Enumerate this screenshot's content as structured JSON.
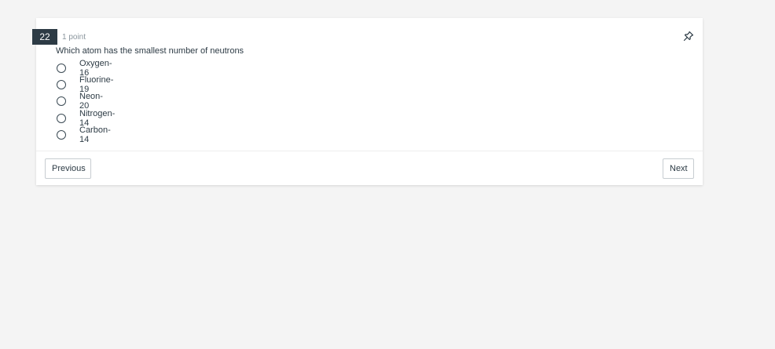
{
  "question": {
    "number": "22",
    "points": "1 point",
    "text": "Which atom has the smallest number of neutrons",
    "answers": [
      {
        "label": "Oxygen-16"
      },
      {
        "label": "Fluorine-19"
      },
      {
        "label": "Neon-20"
      },
      {
        "label": "Nitrogen-14"
      },
      {
        "label": "Carbon-14"
      }
    ]
  },
  "navigation": {
    "previous_label": "Previous",
    "next_label": "Next"
  },
  "icons": {
    "pin": "pin-icon"
  },
  "colors": {
    "background": "#f4f4f4",
    "card": "#ffffff",
    "number_badge": "#2d3b45",
    "text": "#2d3b45",
    "muted": "#8b969e",
    "button_border": "#c7cdd1"
  }
}
